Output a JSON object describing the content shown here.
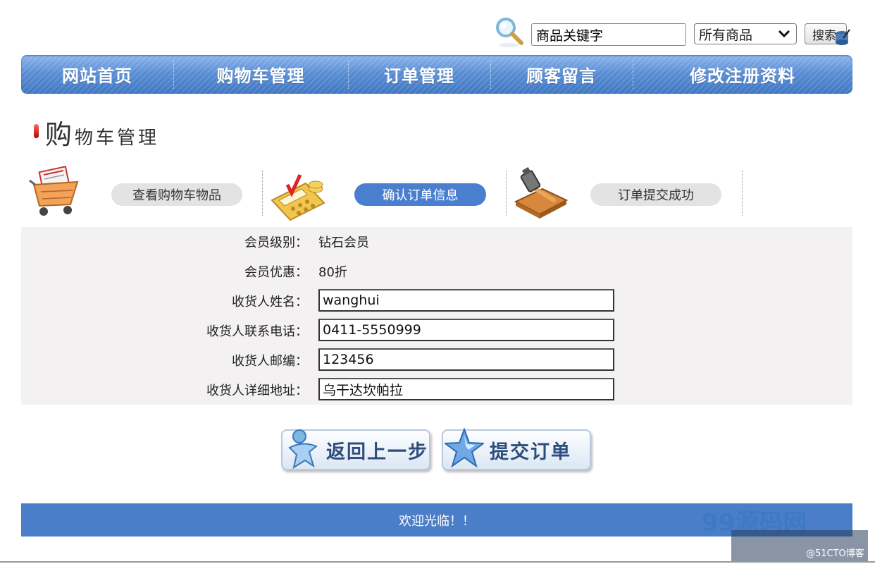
{
  "search": {
    "keyword_value": "商品关键字",
    "category_selected": "所有商品",
    "button_label": "搜索"
  },
  "nav": {
    "items": [
      "网站首页",
      "购物车管理",
      "订单管理",
      "顾客留言",
      "修改注册资料"
    ]
  },
  "page": {
    "title_first": "购",
    "title_rest": "物车管理"
  },
  "steps": [
    {
      "label": "查看购物车物品",
      "active": false,
      "icon": "shopping-cart-icon"
    },
    {
      "label": "确认订单信息",
      "active": true,
      "icon": "calculator-icon"
    },
    {
      "label": "订单提交成功",
      "active": false,
      "icon": "gavel-icon"
    }
  ],
  "form": {
    "member_level_label": "会员级别：",
    "member_level_value": "钻石会员",
    "member_discount_label": "会员优惠：",
    "member_discount_value": "80折",
    "consignee_name_label": "收货人姓名：",
    "consignee_name_value": "wanghui",
    "consignee_phone_label": "收货人联系电话：",
    "consignee_phone_value": "0411-5550999",
    "consignee_zip_label": "收货人邮编：",
    "consignee_zip_value": "123456",
    "consignee_address_label": "收货人详细地址：",
    "consignee_address_value": "乌干达坎帕拉"
  },
  "actions": {
    "back_label": "返回上一步",
    "submit_label": "提交订单"
  },
  "footer": {
    "text": "欢迎光临！！"
  },
  "watermark": {
    "logo_text": "99源码网",
    "tag_text": "@51CTO博客"
  },
  "colors": {
    "nav_blue": "#5a8ed4",
    "active_pill": "#4a7fcf",
    "footer_blue": "#4a7ec9"
  }
}
